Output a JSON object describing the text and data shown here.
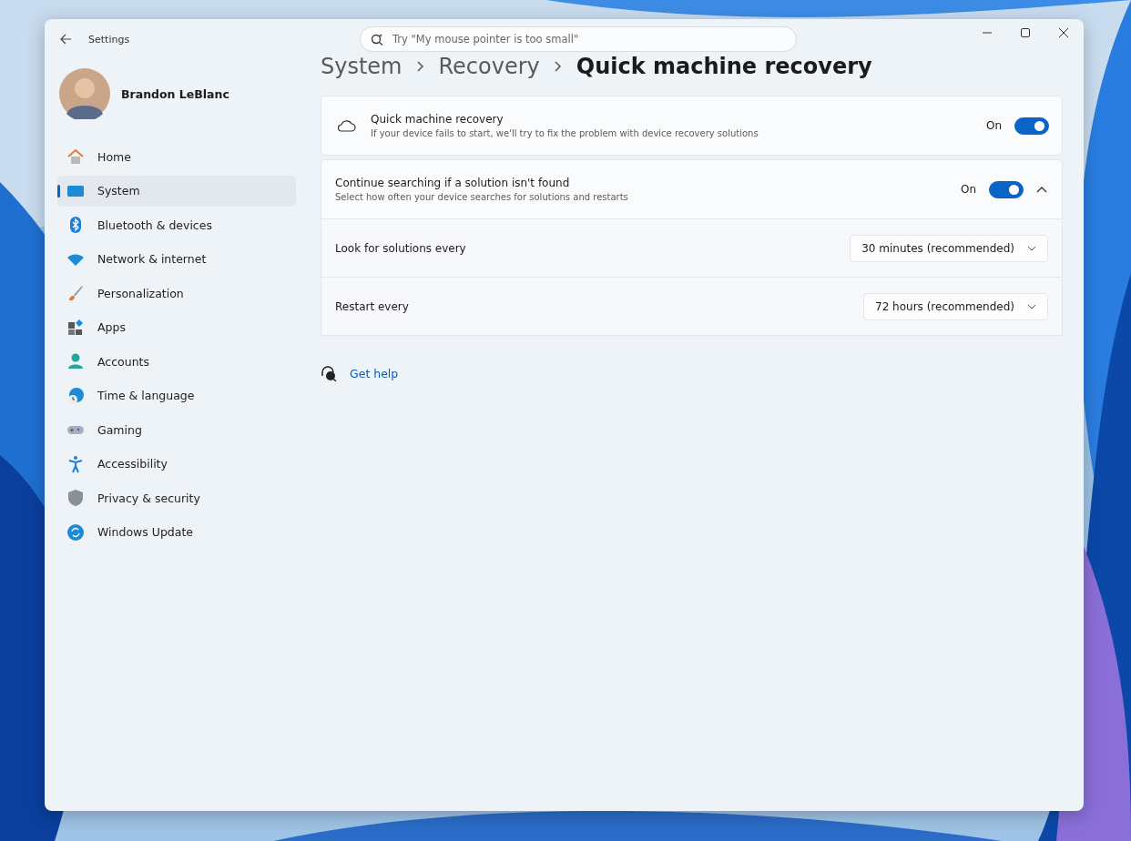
{
  "window": {
    "title": "Settings"
  },
  "search": {
    "placeholder": "Try \"My mouse pointer is too small\""
  },
  "user": {
    "name": "Brandon LeBlanc"
  },
  "sidebar": {
    "items": [
      {
        "label": "Home",
        "kind": "home",
        "selected": false
      },
      {
        "label": "System",
        "kind": "system",
        "selected": true
      },
      {
        "label": "Bluetooth & devices",
        "kind": "bluetooth",
        "selected": false
      },
      {
        "label": "Network & internet",
        "kind": "wifi",
        "selected": false
      },
      {
        "label": "Personalization",
        "kind": "brush",
        "selected": false
      },
      {
        "label": "Apps",
        "kind": "apps",
        "selected": false
      },
      {
        "label": "Accounts",
        "kind": "person",
        "selected": false
      },
      {
        "label": "Time & language",
        "kind": "clock",
        "selected": false
      },
      {
        "label": "Gaming",
        "kind": "gamepad",
        "selected": false
      },
      {
        "label": "Accessibility",
        "kind": "accessibility",
        "selected": false
      },
      {
        "label": "Privacy & security",
        "kind": "shield",
        "selected": false
      },
      {
        "label": "Windows Update",
        "kind": "update",
        "selected": false
      }
    ]
  },
  "breadcrumb": [
    "System",
    "Recovery",
    "Quick machine recovery"
  ],
  "settings": [
    {
      "kind": "toggle",
      "title": "Quick machine recovery",
      "description": "If your device fails to start, we'll try to fix the problem with device recovery solutions",
      "state_label": "On",
      "on": true
    },
    {
      "kind": "expander",
      "title": "Continue searching if a solution isn't found",
      "description": "Select how often your device searches for solutions and restarts",
      "state_label": "On",
      "on": true,
      "expanded": true,
      "children": [
        {
          "label": "Look for solutions every",
          "value": "30 minutes (recommended)"
        },
        {
          "label": "Restart every",
          "value": "72 hours (recommended)"
        }
      ]
    }
  ],
  "help_link": "Get help"
}
